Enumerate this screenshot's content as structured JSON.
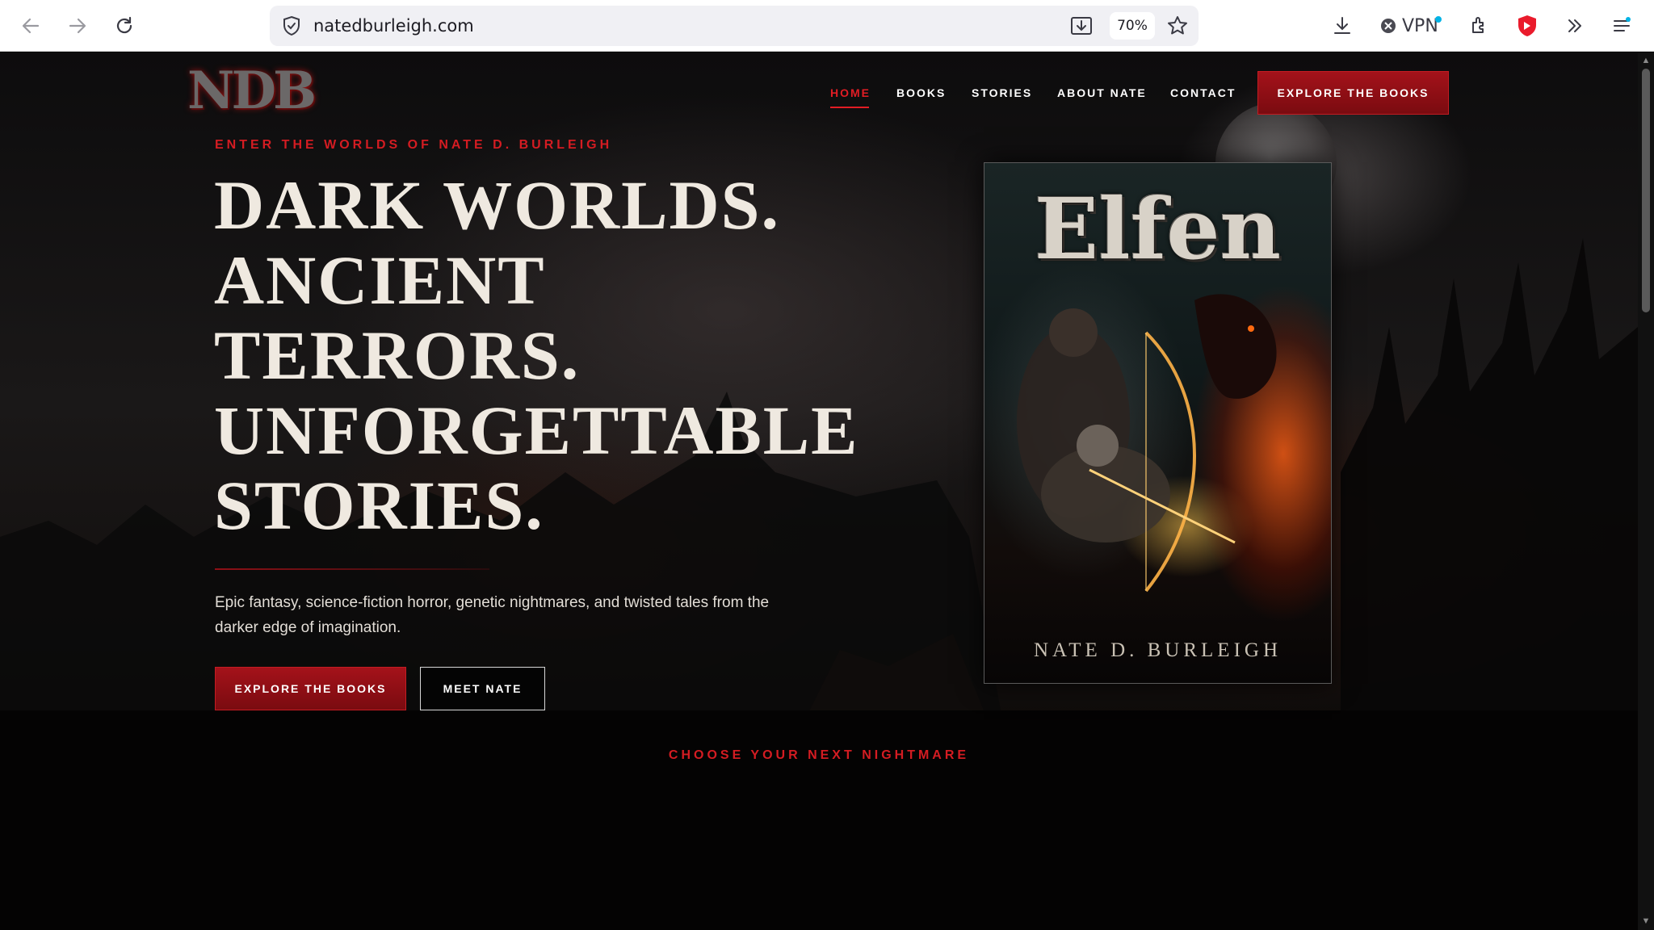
{
  "browser": {
    "url": "natedburleigh.com",
    "zoom": "70%",
    "vpn_label": "VPN"
  },
  "site": {
    "logo_text": "NDB",
    "nav": {
      "items": [
        "HOME",
        "BOOKS",
        "STORIES",
        "ABOUT NATE",
        "CONTACT"
      ],
      "active": "HOME",
      "cta_label": "EXPLORE THE BOOKS"
    },
    "hero": {
      "eyebrow": "ENTER THE WORLDS OF NATE D. BURLEIGH",
      "headline_lines": [
        "DARK WORLDS.",
        "ANCIENT",
        "TERRORS.",
        "UNFORGETTABLE",
        "STORIES."
      ],
      "description": "Epic fantasy, science-fiction horror, genetic nightmares, and twisted tales from the darker edge of imagination.",
      "primary_button": "EXPLORE THE BOOKS",
      "secondary_button": "MEET NATE"
    },
    "featured_book": {
      "title": "Elfen",
      "author": "NATE D. BURLEIGH"
    },
    "next_section": {
      "eyebrow": "CHOOSE YOUR NEXT NIGHTMARE"
    }
  },
  "colors": {
    "accent_red": "#e21d24",
    "button_red": "#a4121a",
    "headline": "#efe9e0",
    "background": "#000000"
  },
  "icons": [
    "back-arrow-icon",
    "forward-arrow-icon",
    "reload-icon",
    "shield-icon",
    "download-page-icon",
    "star-icon",
    "download-icon",
    "vpn-icon",
    "extensions-icon",
    "brave-shield-icon",
    "overflow-icon",
    "menu-icon"
  ]
}
